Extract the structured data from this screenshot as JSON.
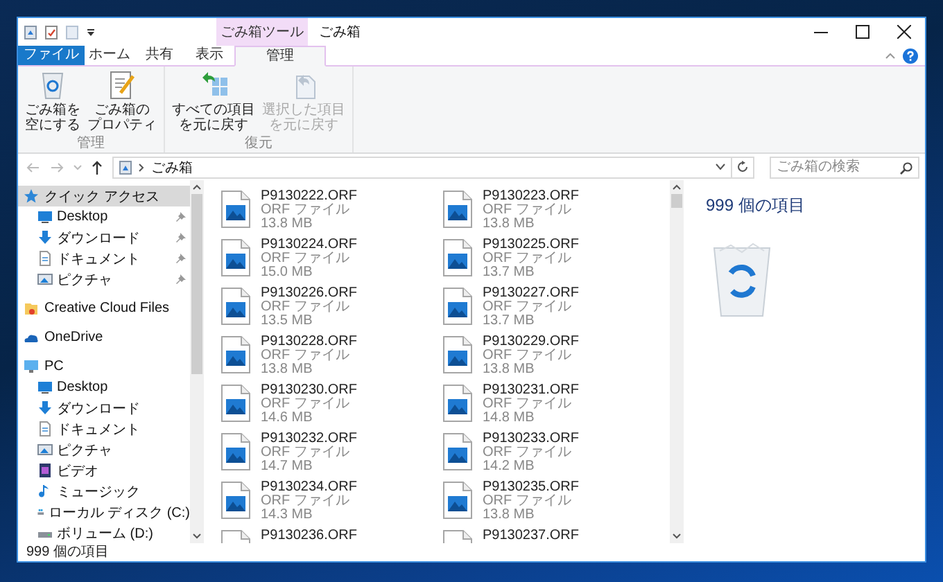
{
  "window": {
    "title": "ごみ箱",
    "context_tab_group": "ごみ箱ツール"
  },
  "tabs": [
    {
      "label": "ファイル",
      "kind": "file",
      "selected": false
    },
    {
      "label": "ホーム",
      "kind": "normal",
      "selected": false
    },
    {
      "label": "共有",
      "kind": "normal",
      "selected": false
    },
    {
      "label": "表示",
      "kind": "normal",
      "selected": false
    },
    {
      "label": "管理",
      "kind": "contextual",
      "selected": true
    }
  ],
  "ribbon": {
    "groups": [
      {
        "label": "管理",
        "buttons": [
          {
            "lines": [
              "ごみ箱を",
              "空にする"
            ],
            "kind": "empty-bin",
            "disabled": false
          },
          {
            "lines": [
              "ごみ箱の",
              "プロパティ"
            ],
            "kind": "properties",
            "disabled": false
          }
        ]
      },
      {
        "label": "復元",
        "buttons": [
          {
            "lines": [
              "すべての項目",
              "を元に戻す"
            ],
            "kind": "restore-all",
            "disabled": false
          },
          {
            "lines": [
              "選択した項目",
              "を元に戻す"
            ],
            "kind": "restore-selected",
            "disabled": true
          }
        ]
      }
    ]
  },
  "address_bar": {
    "path": "ごみ箱",
    "search": {
      "placeholder": "ごみ箱の検索"
    }
  },
  "navigation": [
    {
      "label": "クイック アクセス",
      "kind": "star",
      "selected": true,
      "children": [
        {
          "label": "Desktop",
          "kind": "desktop",
          "selected": false,
          "pinned": true
        },
        {
          "label": "ダウンロード",
          "kind": "download",
          "selected": false,
          "pinned": true
        },
        {
          "label": "ドキュメント",
          "kind": "document",
          "selected": false,
          "pinned": true
        },
        {
          "label": "ピクチャ",
          "kind": "picture",
          "selected": false,
          "pinned": true
        }
      ]
    },
    {
      "label": "Creative Cloud Files",
      "kind": "cc",
      "selected": false
    },
    {
      "label": "OneDrive",
      "kind": "cloud",
      "selected": false
    },
    {
      "label": "PC",
      "kind": "pc",
      "selected": false,
      "children": [
        {
          "label": "Desktop",
          "kind": "desktop",
          "selected": false,
          "pinned": false
        },
        {
          "label": "ダウンロード",
          "kind": "download",
          "selected": false,
          "pinned": false
        },
        {
          "label": "ドキュメント",
          "kind": "document",
          "selected": false,
          "pinned": false
        },
        {
          "label": "ピクチャ",
          "kind": "picture",
          "selected": false,
          "pinned": false
        },
        {
          "label": "ビデオ",
          "kind": "video",
          "selected": false,
          "pinned": false
        },
        {
          "label": "ミュージック",
          "kind": "music",
          "selected": false,
          "pinned": false
        },
        {
          "label": "ローカル ディスク (C:)",
          "kind": "system-drive",
          "selected": false,
          "pinned": false
        },
        {
          "label": "ボリューム (D:)",
          "kind": "drive",
          "selected": false,
          "pinned": false
        }
      ]
    }
  ],
  "files": [
    {
      "name": "P9130222.ORF",
      "type": "ORF ファイル",
      "size": "13.8 MB"
    },
    {
      "name": "P9130223.ORF",
      "type": "ORF ファイル",
      "size": "13.8 MB"
    },
    {
      "name": "P9130224.ORF",
      "type": "ORF ファイル",
      "size": "15.0 MB"
    },
    {
      "name": "P9130225.ORF",
      "type": "ORF ファイル",
      "size": "13.7 MB"
    },
    {
      "name": "P9130226.ORF",
      "type": "ORF ファイル",
      "size": "13.5 MB"
    },
    {
      "name": "P9130227.ORF",
      "type": "ORF ファイル",
      "size": "13.7 MB"
    },
    {
      "name": "P9130228.ORF",
      "type": "ORF ファイル",
      "size": "13.8 MB"
    },
    {
      "name": "P9130229.ORF",
      "type": "ORF ファイル",
      "size": "13.8 MB"
    },
    {
      "name": "P9130230.ORF",
      "type": "ORF ファイル",
      "size": "14.6 MB"
    },
    {
      "name": "P9130231.ORF",
      "type": "ORF ファイル",
      "size": "14.8 MB"
    },
    {
      "name": "P9130232.ORF",
      "type": "ORF ファイル",
      "size": "14.7 MB"
    },
    {
      "name": "P9130233.ORF",
      "type": "ORF ファイル",
      "size": "14.2 MB"
    },
    {
      "name": "P9130234.ORF",
      "type": "ORF ファイル",
      "size": "14.3 MB"
    },
    {
      "name": "P9130235.ORF",
      "type": "ORF ファイル",
      "size": "13.8 MB"
    },
    {
      "name": "P9130236.ORF"
    },
    {
      "name": "P9130237.ORF"
    }
  ],
  "details": {
    "title": "999 個の項目"
  },
  "status_bar": {
    "item_count": "999 個の項目"
  }
}
